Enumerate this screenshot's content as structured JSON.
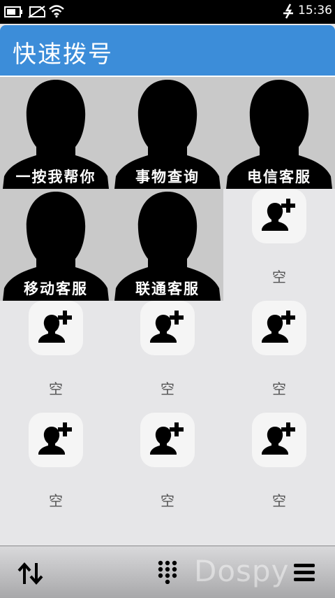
{
  "status_bar": {
    "time": "15:36",
    "icons": [
      "battery-icon",
      "no-sim-icon",
      "wifi-icon",
      "usb-icon"
    ]
  },
  "header": {
    "title": "快速拨号"
  },
  "contacts": [
    {
      "name": "一按我帮你"
    },
    {
      "name": "事物查询"
    },
    {
      "name": "电信客服"
    },
    {
      "name": "移动客服"
    },
    {
      "name": "联通客服"
    }
  ],
  "empty_slots": [
    {
      "label": "空"
    },
    {
      "label": "空"
    },
    {
      "label": "空"
    },
    {
      "label": "空"
    },
    {
      "label": "空"
    },
    {
      "label": "空"
    },
    {
      "label": "空"
    }
  ],
  "toolbar": {
    "icons": [
      "sort-arrows-icon",
      "dialpad-icon",
      "menu-icon"
    ]
  },
  "watermark": {
    "text": "Dospy"
  },
  "colors": {
    "header": "#3c8dd9",
    "background": "#e6e6e8",
    "contact_bg": "#c9c9c9"
  }
}
